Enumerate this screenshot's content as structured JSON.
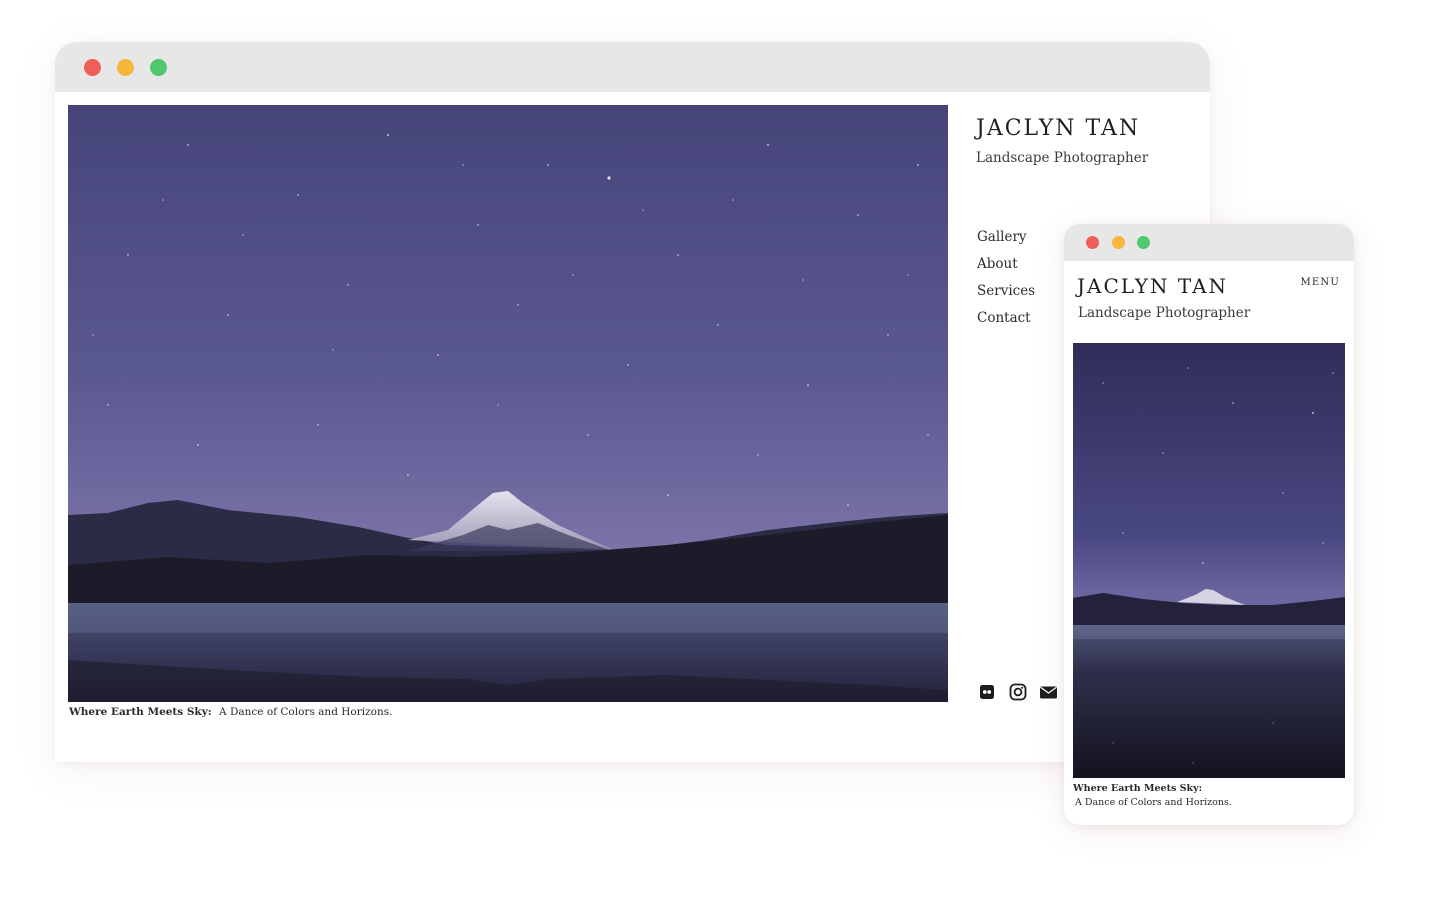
{
  "desktop": {
    "window_controls": [
      "close",
      "minimize",
      "maximize"
    ],
    "site": {
      "title": "JACLYN TAN",
      "subtitle": "Landscape Photographer"
    },
    "nav": [
      {
        "label": "Gallery"
      },
      {
        "label": "About"
      },
      {
        "label": "Services"
      },
      {
        "label": "Contact"
      }
    ],
    "hero_image": {
      "subject": "starry night sky over snow-capped mountain reflected in lake"
    },
    "caption": {
      "title": "Where Earth Meets Sky:",
      "text": "A Dance of Colors and Horizons."
    },
    "social_icons": [
      "flickr-icon",
      "instagram-icon",
      "email-icon"
    ]
  },
  "mobile": {
    "window_controls": [
      "close",
      "minimize",
      "maximize"
    ],
    "site": {
      "title": "JACLYN TAN",
      "subtitle": "Landscape Photographer",
      "menu_label": "MENU"
    },
    "caption": {
      "title": "Where Earth Meets Sky:",
      "text": "A Dance of Colors and Horizons."
    }
  },
  "colors": {
    "titlebar": "#e8e7e7",
    "close": "#ef5f5a",
    "minimize": "#f6b73a",
    "maximize": "#52c86e",
    "text": "#1f1f1f"
  }
}
